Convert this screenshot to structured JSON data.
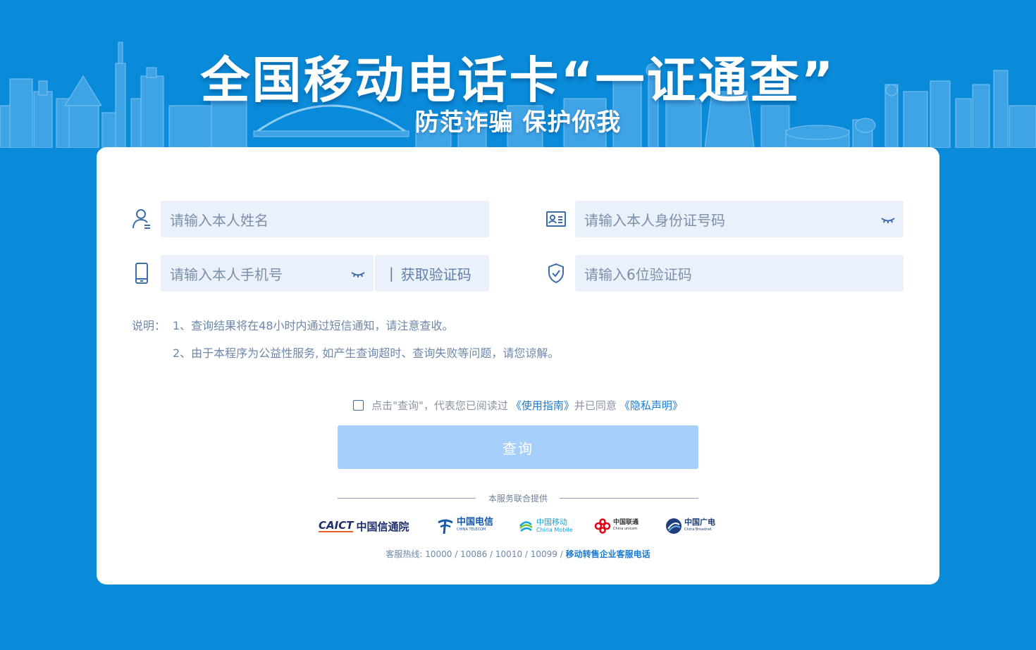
{
  "banner": {
    "title": "全国移动电话卡“一证通查”",
    "subtitle": "防范诈骗 保护你我"
  },
  "form": {
    "name_placeholder": "请输入本人姓名",
    "id_placeholder": "请输入本人身份证号码",
    "phone_placeholder": "请输入本人手机号",
    "sms_button_label": "获取验证码",
    "sms_separator": "|",
    "code_placeholder": "请输入6位验证码"
  },
  "notes": {
    "label": "说明：",
    "line1": "1、查询结果将在48小时内通过短信通知，请注意查收。",
    "line2": "2、由于本程序为公益性服务, 如产生查询超时、查询失败等问题，请您谅解。"
  },
  "agreement": {
    "prefix": "点击\"查询\"，代表您已阅读过",
    "guide_link": "《使用指南》",
    "middle": "并已同意",
    "privacy_link": "《隐私声明》",
    "checked": false
  },
  "query_button": {
    "label": "查询"
  },
  "providers": {
    "label": "本服务联合提供",
    "caict_en": "CAICT",
    "caict_cn": "中国信通院",
    "telecom_cn": "中国电信",
    "telecom_en": "CHINA TELECOM",
    "mobile_cn": "中国移动",
    "mobile_en": "China Mobile",
    "unicom_cn": "中国联通",
    "unicom_en": "China unicom",
    "broadnet_cn": "中国广电",
    "broadnet_en": "China Broadnet"
  },
  "hotline": {
    "prefix": "客服热线: 10000 / 10086 / 10010 / 10099 / ",
    "link": "移动转售企业客服电话"
  },
  "colors": {
    "background": "#0a8bd9",
    "field_bg": "#eaf1fb",
    "button_bg": "#a6d0fb",
    "link": "#1a7ad1"
  }
}
